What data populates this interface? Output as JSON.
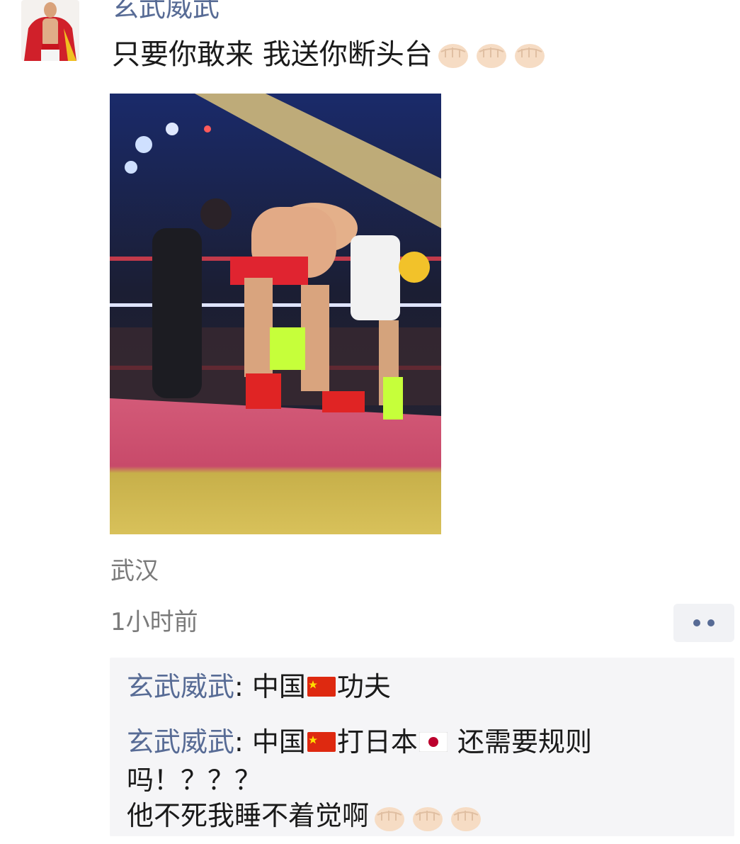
{
  "post": {
    "username": "玄武威武",
    "text": "只要你敢来 我送你断头台",
    "text_emoji": [
      "fist-emoji",
      "fist-emoji",
      "fist-emoji"
    ],
    "location": "武汉",
    "time": "1小时前"
  },
  "comments": [
    {
      "name": "玄武威武",
      "sep": ":",
      "part1": " 中国",
      "flag1": "china-flag",
      "part2": "功夫"
    },
    {
      "name": "玄武威武",
      "sep": ":",
      "part1": " 中国",
      "flag1": "china-flag",
      "part2": "打日本",
      "flag2": "japan-flag",
      "part3": " 还需要规则",
      "line2": "吗！？？？",
      "line3": "他不死我睡不着觉啊",
      "line3_emoji": [
        "fist-emoji",
        "fist-emoji",
        "fist-emoji"
      ]
    }
  ],
  "colors": {
    "link": "#576b95",
    "meta": "#7a7a7a",
    "comment_bg": "#f5f5f7"
  }
}
